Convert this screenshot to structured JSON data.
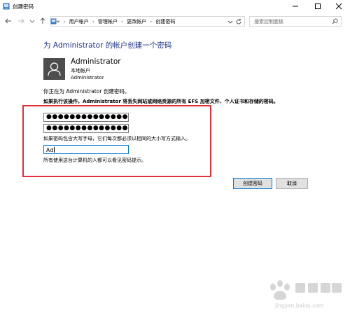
{
  "window": {
    "title": "创建密码"
  },
  "nav": {
    "breadcrumbs": [
      "«",
      "用户帐户",
      "管理帐户",
      "更改帐户",
      "创建密码"
    ],
    "search_placeholder": "搜索控制面板"
  },
  "main": {
    "heading": "为 Administrator 的帐户创建一个密码",
    "user": {
      "name": "Administrator",
      "type": "本地帐户",
      "name2": "Administrator"
    },
    "intro": "你正在为 Administrator 创建密码。",
    "warning": "如果执行该操作，Administrator 将丢失网站或网络资源的所有 EFS 加密文件、个人证书和存储的密码。",
    "password_value": "●●●●●●●●●●●●●●",
    "confirm_value": "●●●●●●●●●●●●●●",
    "case_note": "如果密码包含大写字母，它们每次都必须以相同的大小写方式输入。",
    "hint_value": "Ad",
    "hint_note": "所有使用这台计算机的人都可以看见密码提示。"
  },
  "buttons": {
    "create": "创建密码",
    "cancel": "取消"
  },
  "watermark": {
    "text": "jingyan.baidu.com"
  },
  "colors": {
    "heading": "#1e3287",
    "highlight_box": "#e0303a",
    "focus": "#0078d7"
  }
}
